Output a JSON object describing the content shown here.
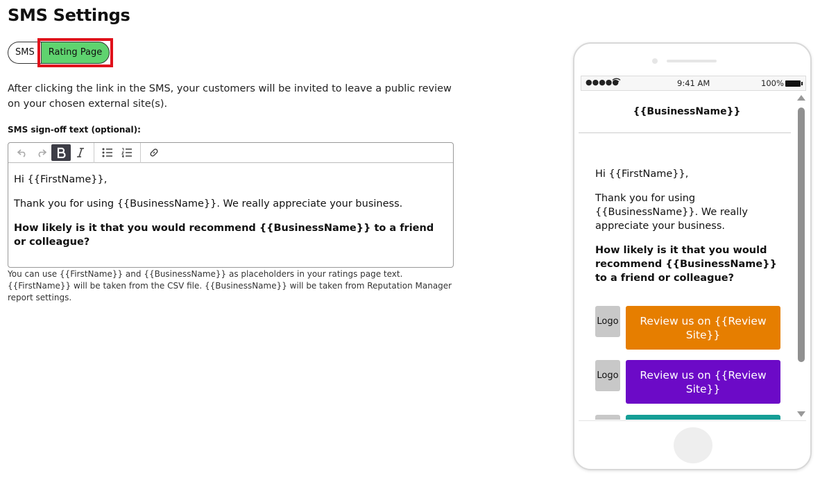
{
  "page": {
    "title": "SMS Settings"
  },
  "tabs": [
    {
      "label": "SMS",
      "active": false
    },
    {
      "label": "Rating Page",
      "active": true
    }
  ],
  "intro_text": "After clicking the link in the SMS, your customers will be invited to leave a public review on your chosen external site(s).",
  "editor": {
    "label": "SMS sign-off text (optional):",
    "toolbar": {
      "undo_icon": "undo-icon",
      "redo_icon": "redo-icon",
      "bold_icon": "bold-icon",
      "italic_icon": "italic-icon",
      "bullet_list_icon": "bullet-list-icon",
      "numbered_list_icon": "numbered-list-icon",
      "link_icon": "link-icon"
    },
    "paragraphs": [
      "Hi {{FirstName}},",
      "Thank you for using {{BusinessName}}. We really appreciate your business.",
      "How likely is it that you would recommend {{BusinessName}} to a friend or colleague?"
    ],
    "help_text": "You can use {{FirstName}} and {{BusinessName}} as placeholders in your ratings page text. {{FirstName}} will be taken from the CSV file. {{BusinessName}} will be taken from Reputation Manager report settings."
  },
  "preview": {
    "status_bar": {
      "signal": "●●●●●",
      "time": "9:41 AM",
      "battery": "100%"
    },
    "header": "{{BusinessName}}",
    "greeting": "Hi {{FirstName}},",
    "thanks": "Thank you for using {{BusinessName}}. We really appreciate your business.",
    "question": "How likely is it that you would recommend {{BusinessName}} to a friend or colleague?",
    "review_buttons": [
      {
        "logo": "Logo",
        "label": "Review us on {{Review Site}}",
        "color": "#e67e00"
      },
      {
        "logo": "Logo",
        "label": "Review us on {{Review Site}}",
        "color": "#6c0ac7"
      },
      {
        "logo": "",
        "label": "",
        "color": "#159e96"
      }
    ]
  },
  "colors": {
    "active_tab": "#5fd36f",
    "highlight": "#e0111b"
  }
}
